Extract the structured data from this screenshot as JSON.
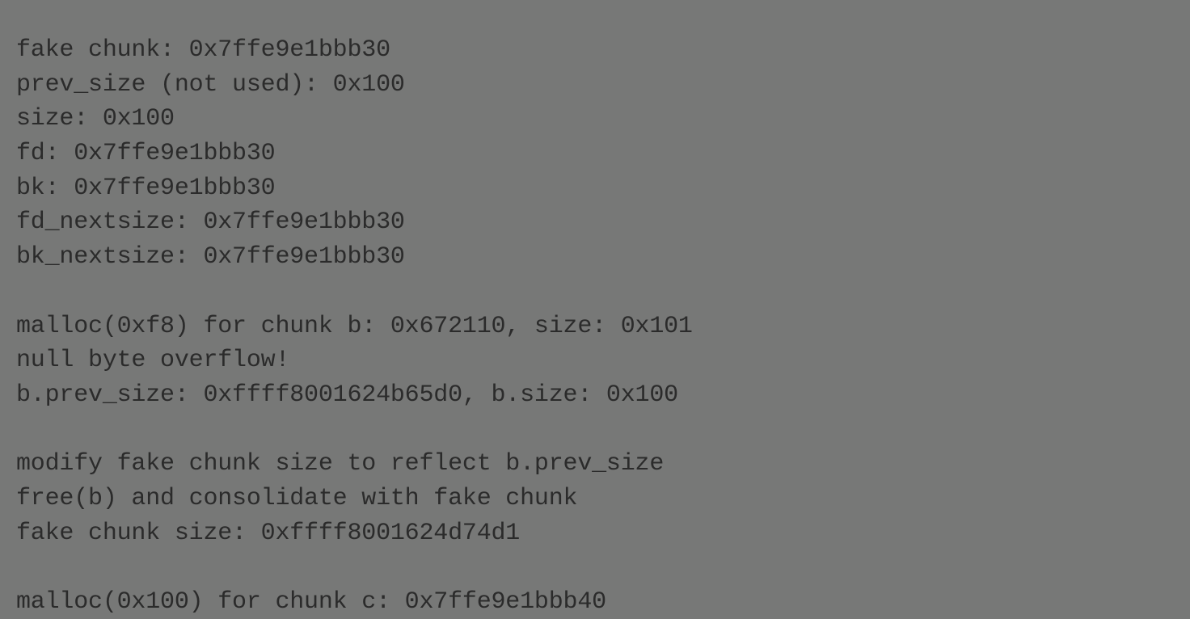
{
  "terminal": {
    "lines": [
      "fake chunk: 0x7ffe9e1bbb30",
      "prev_size (not used): 0x100",
      "size: 0x100",
      "fd: 0x7ffe9e1bbb30",
      "bk: 0x7ffe9e1bbb30",
      "fd_nextsize: 0x7ffe9e1bbb30",
      "bk_nextsize: 0x7ffe9e1bbb30",
      "",
      "malloc(0xf8) for chunk b: 0x672110, size: 0x101",
      "null byte overflow!",
      "b.prev_size: 0xffff8001624b65d0, b.size: 0x100",
      "",
      "modify fake chunk size to reflect b.prev_size",
      "free(b) and consolidate with fake chunk",
      "fake chunk size: 0xffff8001624d74d1",
      "",
      "malloc(0x100) for chunk c: 0x7ffe9e1bbb40"
    ]
  }
}
